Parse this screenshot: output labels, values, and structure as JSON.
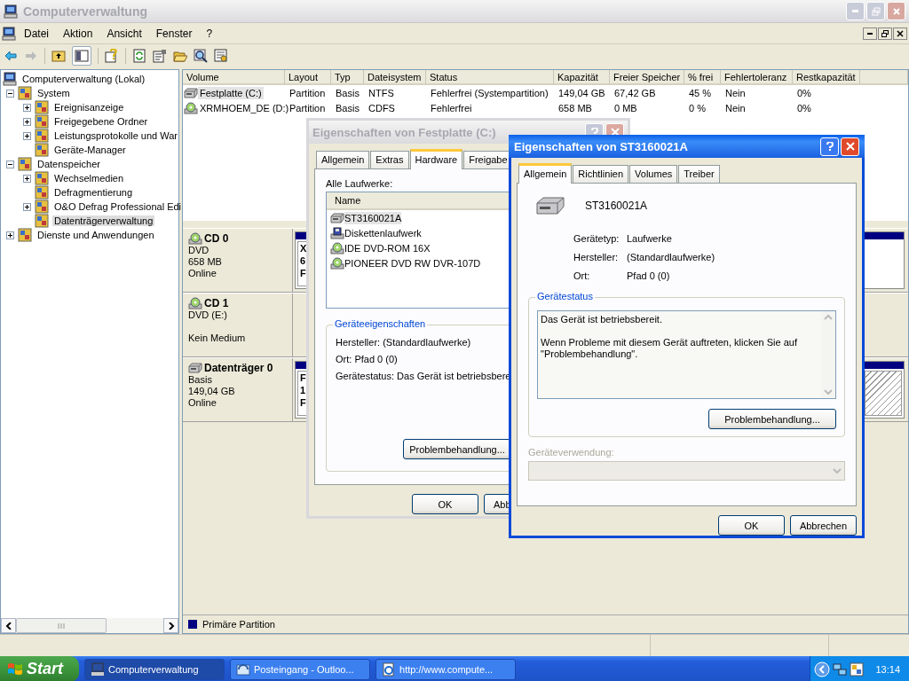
{
  "window": {
    "title": "Computerverwaltung"
  },
  "menu": [
    {
      "label": "Datei"
    },
    {
      "label": "Aktion"
    },
    {
      "label": "Ansicht"
    },
    {
      "label": "Fenster"
    },
    {
      "label": "?"
    }
  ],
  "tree": {
    "label": "Computerverwaltung (Lokal)",
    "selected": false,
    "children": [
      {
        "label": "System",
        "expandable": true,
        "expanded": true,
        "selected": false,
        "children": [
          {
            "label": "Ereignisanzeige",
            "expandable": true,
            "expanded": false,
            "selected": false
          },
          {
            "label": "Freigegebene Ordner",
            "expandable": true,
            "expanded": false,
            "selected": false
          },
          {
            "label": "Leistungsprotokolle und War",
            "expandable": true,
            "expanded": false,
            "selected": false
          },
          {
            "label": "Geräte-Manager",
            "expandable": false,
            "selected": false
          }
        ]
      },
      {
        "label": "Datenspeicher",
        "expandable": true,
        "expanded": true,
        "selected": false,
        "children": [
          {
            "label": "Wechselmedien",
            "expandable": true,
            "expanded": false,
            "selected": false
          },
          {
            "label": "Defragmentierung",
            "expandable": false,
            "selected": false
          },
          {
            "label": "O&O Defrag Professional Edi",
            "expandable": true,
            "expanded": false,
            "selected": false
          },
          {
            "label": "Datenträgerverwaltung",
            "expandable": false,
            "selected": true
          }
        ]
      },
      {
        "label": "Dienste und Anwendungen",
        "expandable": true,
        "expanded": false,
        "selected": false
      }
    ]
  },
  "volumes": {
    "columns": [
      "Volume",
      "Layout",
      "Typ",
      "Dateisystem",
      "Status",
      "Kapazität",
      "Freier Speicher",
      "% frei",
      "Fehlertoleranz",
      "Restkapazität"
    ],
    "rows": [
      {
        "kind": "disk",
        "selected": true,
        "cells": [
          "Festplatte (C:)",
          "Partition",
          "Basis",
          "NTFS",
          "Fehlerfrei (Systempartition)",
          "149,04 GB",
          "67,42 GB",
          "45 %",
          "Nein",
          "0%"
        ]
      },
      {
        "kind": "cd",
        "selected": false,
        "cells": [
          "XRMHOEM_DE (D:)",
          "Partition",
          "Basis",
          "CDFS",
          "Fehlerfrei",
          "658 MB",
          "0 MB",
          "0 %",
          "Nein",
          "0%"
        ]
      }
    ]
  },
  "disks": [
    {
      "kind": "cd",
      "name": "CD 0",
      "type": "DVD",
      "size": "658 MB",
      "status": "Online",
      "partition": [
        "X",
        "6",
        "F"
      ]
    },
    {
      "kind": "cd",
      "name": "CD 1",
      "type": "DVD (E:)",
      "status": "Kein Medium"
    },
    {
      "kind": "disk",
      "name": "Datenträger 0",
      "type": "Basis",
      "size": "149,04 GB",
      "status": "Online",
      "partition": [
        "F",
        "1",
        "F"
      ]
    }
  ],
  "legend": [
    {
      "label": "Primäre Partition",
      "color": "#000080"
    }
  ],
  "back_dialog": {
    "title": "Eigenschaften von Festplatte (C:)",
    "tabs": [
      {
        "label": "Allgemein",
        "selected": false
      },
      {
        "label": "Extras",
        "selected": false
      },
      {
        "label": "Hardware",
        "selected": true
      },
      {
        "label": "Freigabe",
        "selected": false
      }
    ],
    "list_label": "Alle Laufwerke:",
    "list_header": "Name",
    "drives": [
      {
        "kind": "disk",
        "label": "ST3160021A",
        "selected": true
      },
      {
        "kind": "floppy",
        "label": "Diskettenlaufwerk",
        "selected": false
      },
      {
        "kind": "cd",
        "label": "IDE DVD-ROM 16X",
        "selected": false
      },
      {
        "kind": "cd",
        "label": "PIONEER DVD RW  DVR-107D",
        "selected": false
      }
    ],
    "group": "Geräteeigenschaften",
    "lines": [
      "Hersteller: (Standardlaufwerke)",
      "Ort: Pfad 0 (0)",
      "Gerätestatus: Das Gerät ist betriebsbere"
    ],
    "button": "Problembehandlung...",
    "ok": "OK",
    "cancel": "Abb"
  },
  "front_dialog": {
    "title": "Eigenschaften von ST3160021A",
    "tabs": [
      {
        "label": "Allgemein",
        "selected": true
      },
      {
        "label": "Richtlinien",
        "selected": false
      },
      {
        "label": "Volumes",
        "selected": false
      },
      {
        "label": "Treiber",
        "selected": false
      }
    ],
    "device": "ST3160021A",
    "props": [
      {
        "label": "Gerätetyp:",
        "value": "Laufwerke"
      },
      {
        "label": "Hersteller:",
        "value": "(Standardlaufwerke)"
      },
      {
        "label": "Ort:",
        "value": "Pfad 0 (0)"
      }
    ],
    "group": "Gerätestatus",
    "status": [
      "Das Gerät ist betriebsbereit.",
      "Wenn Probleme mit diesem Gerät auftreten, klicken Sie auf \"Problembehandlung\"."
    ],
    "button": "Problembehandlung...",
    "usage": {
      "label": "Geräteverwendung:",
      "disabled": true
    },
    "ok": "OK",
    "cancel": "Abbrechen"
  },
  "taskbar": {
    "start": "Start",
    "tasks": [
      {
        "label": "Computerverwaltung",
        "selected": true
      },
      {
        "label": "Posteingang - Outloo...",
        "selected": false
      },
      {
        "label": "http://www.compute...",
        "selected": false
      }
    ],
    "clock": "13:14"
  }
}
